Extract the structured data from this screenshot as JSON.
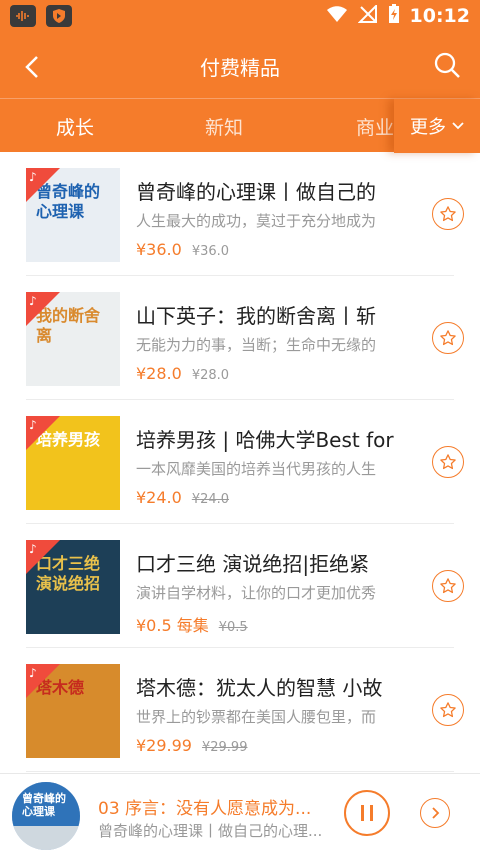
{
  "status": {
    "time": "10:12"
  },
  "header": {
    "title": "付费精品"
  },
  "tabs": [
    {
      "label": "成长"
    },
    {
      "label": "新知"
    },
    {
      "label": "商业"
    }
  ],
  "more_label": "更多",
  "books": [
    {
      "cover_text": "曾奇峰的心理课",
      "cover_bg": "#e9eef3",
      "cover_fg": "#1e62b0",
      "title": "曾奇峰的心理课丨做自己的",
      "desc": "人生最大的成功，莫过于充分地成为",
      "price": "¥36.0",
      "original_price": "¥36.0",
      "strike": false
    },
    {
      "cover_text": "我的断舍离",
      "cover_bg": "#eceff0",
      "cover_fg": "#d98a2e",
      "title": "山下英子：我的断舍离丨斩",
      "desc": "无能为力的事，当断；生命中无缘的",
      "price": "¥28.0",
      "original_price": "¥28.0",
      "strike": false
    },
    {
      "cover_text": "培养男孩",
      "cover_bg": "#f2c31c",
      "cover_fg": "#ffffff",
      "title": "培养男孩 | 哈佛大学Best for",
      "desc": "一本风靡美国的培养当代男孩的人生",
      "price": "¥24.0",
      "original_price": "¥24.0",
      "strike": true
    },
    {
      "cover_text": "口才三绝 演说绝招",
      "cover_bg": "#1d3f57",
      "cover_fg": "#e9c14b",
      "title": "口才三绝 演说绝招|拒绝紧",
      "desc": "演讲自学材料，让你的口才更加优秀",
      "price": "¥0.5 每集",
      "original_price": "¥0.5",
      "strike": true
    },
    {
      "cover_text": "塔木德",
      "cover_bg": "#d78b2c",
      "cover_fg": "#c62b1e",
      "title": "塔木德：犹太人的智慧 小故",
      "desc": "世界上的钞票都在美国人腰包里，而",
      "price": "¥29.99",
      "original_price": "¥29.99",
      "strike": true
    }
  ],
  "player": {
    "title": "03 序言：没有人愿意成为...",
    "subtitle": "曾奇峰的心理课丨做自己的心理...",
    "cover_text": "曾奇峰的心理课"
  },
  "colors": {
    "accent": "#f57c2b",
    "badge": "#f04b3c"
  }
}
